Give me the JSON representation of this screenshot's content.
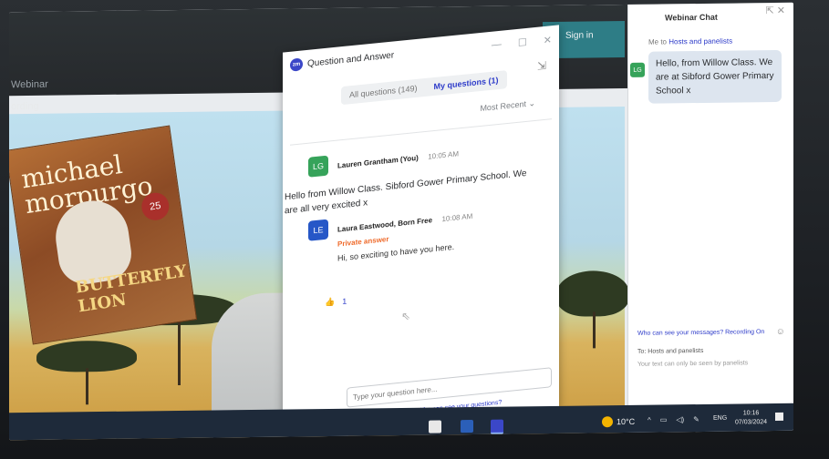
{
  "zoom": {
    "window_title": "Webinar",
    "recording_label": "ording",
    "sign_in": "Sign in"
  },
  "book": {
    "author": "michael morpurgo",
    "title": "BUTTERFLY LION",
    "badge": "25"
  },
  "qa": {
    "title": "Question and Answer",
    "logo": "zm",
    "controls": {
      "minimize": "—",
      "maximize": "☐",
      "close": "✕"
    },
    "tabs": [
      {
        "label": "All questions (149)"
      },
      {
        "label": "My questions (1)"
      }
    ],
    "sort": "Most Recent ⌄",
    "question": {
      "avatar": "LG",
      "author": "Lauren Grantham (You)",
      "time": "10:05 AM",
      "text": "Hello from Willow Class. Sibford Gower Primary School. We are all very excited x"
    },
    "answer": {
      "avatar": "LE",
      "author": "Laura Eastwood, Born Free",
      "time": "10:08 AM",
      "tag": "Private answer",
      "text": "Hi, so exciting to have you here."
    },
    "likes": "1",
    "input_placeholder": "Type your question here...",
    "who_can_see": "Who can see your questions?"
  },
  "chat": {
    "title": "Webinar Chat",
    "me_to": "Me to",
    "recipient": "Hosts and panelists",
    "avatar": "LG",
    "message": "Hello, from Willow Class. We are at Sibford Gower Primary School x",
    "who_can_see": "Who can see your messages? Recording On",
    "to_label": "To: Hosts and panelists",
    "note": "Your text can only be seen by panelists"
  },
  "taskbar": {
    "temperature": "10°C",
    "language": "ENG",
    "time": "10:16",
    "date": "07/03/2024"
  },
  "colors": {
    "zoom_blue": "#2d3bc9",
    "avatar_green": "#36a35a",
    "avatar_blue": "#2657c7",
    "private_orange": "#ef6b2c"
  }
}
